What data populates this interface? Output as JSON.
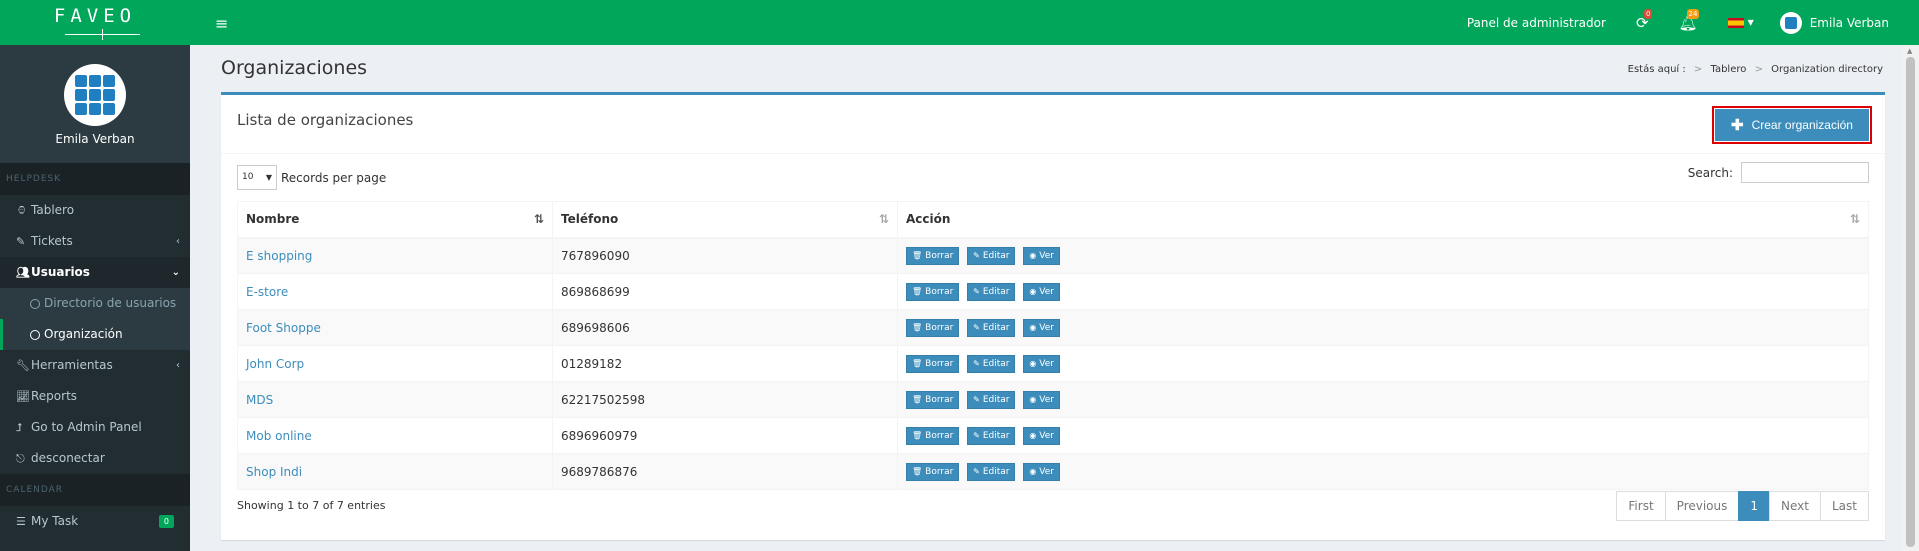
{
  "header": {
    "logo": "FAVEO",
    "admin_panel": "Panel de administrador",
    "refresh_badge": "0",
    "notif_badge": "24",
    "user_name": "Emila Verban"
  },
  "sidebar": {
    "user_name": "Emila Verban",
    "helpdesk_header": "HELPDESK",
    "calendar_header": "CALENDAR",
    "items": {
      "dashboard": "Tablero",
      "tickets": "Tickets",
      "users": "Usuarios",
      "user_directory": "Directorio de usuarios",
      "organization": "Organización",
      "tools": "Herramientas",
      "reports": "Reports",
      "admin_panel": "Go to Admin Panel",
      "logout": "desconectar",
      "my_task": "My Task",
      "my_task_count": "0"
    }
  },
  "page": {
    "title": "Organizaciones",
    "breadcrumb": {
      "label": "Estás aquí :",
      "home": "Tablero",
      "current": "Organization directory"
    }
  },
  "box": {
    "title": "Lista de organizaciones",
    "create_button": "Crear organización",
    "page_length": "10",
    "records_per_page": "Records per page",
    "search_label": "Search:",
    "search_value": "",
    "columns": [
      "Nombre",
      "Teléfono",
      "Acción"
    ],
    "rows": [
      {
        "name": "E shopping",
        "phone": "767896090"
      },
      {
        "name": "E-store",
        "phone": "869868699"
      },
      {
        "name": "Foot Shoppe",
        "phone": "689698606"
      },
      {
        "name": "John Corp",
        "phone": "01289182"
      },
      {
        "name": "MDS",
        "phone": "62217502598"
      },
      {
        "name": "Mob online",
        "phone": "6896960979"
      },
      {
        "name": "Shop Indi",
        "phone": "9689786876"
      }
    ],
    "actions": {
      "delete": "Borrar",
      "edit": "Editar",
      "view": "Ver"
    },
    "info": "Showing 1 to 7 of 7 entries",
    "pagination": {
      "first": "First",
      "previous": "Previous",
      "current": "1",
      "next": "Next",
      "last": "Last"
    }
  },
  "colors": {
    "header_green": "#00a65a",
    "sidebar_dark": "#222d32",
    "primary_blue": "#3c8dbc",
    "highlight_red": "#dd0000"
  }
}
